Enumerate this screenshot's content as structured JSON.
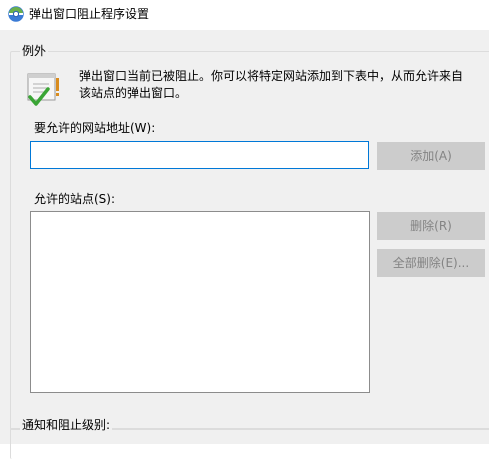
{
  "window": {
    "title": "弹出窗口阻止程序设置"
  },
  "exceptions": {
    "group_label": "例外",
    "info_text": "弹出窗口当前已被阻止。你可以将特定网站添加到下表中，从而允许来自\n该站点的弹出窗口。",
    "address_label": "要允许的网站地址(W):",
    "address_value": "",
    "add_button": "添加(A)",
    "allowed_sites_label": "允许的站点(S):",
    "allowed_sites": [],
    "remove_button": "删除(R)",
    "remove_all_button": "全部删除(E)..."
  },
  "notifications": {
    "group_label": "通知和阻止级别:"
  },
  "colors": {
    "focus_border": "#0078d7",
    "disabled_button_bg": "#cccccc",
    "disabled_button_text": "#838383",
    "dialog_bg": "#f0f0f0"
  }
}
